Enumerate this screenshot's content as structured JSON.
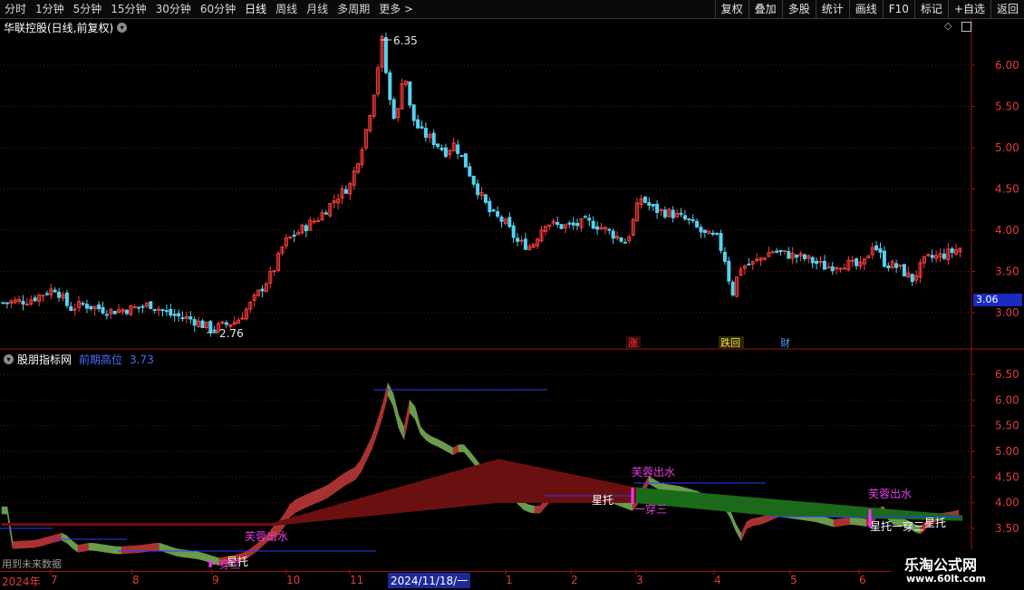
{
  "toolbar": {
    "periods": [
      "分时",
      "1分钟",
      "5分钟",
      "15分钟",
      "30分钟",
      "60分钟",
      "日线",
      "周线",
      "月线",
      "多周期",
      "更多 >"
    ],
    "active_period": "日线",
    "actions": [
      "复权",
      "叠加",
      "多股",
      "统计",
      "画线",
      "F10",
      "标记",
      "+自选",
      "返回"
    ]
  },
  "main_panel": {
    "title": "华联控股(日线,前复权)",
    "high_label": "6.35",
    "low_label": "2.76",
    "current_price": "3.06",
    "markers": [
      "涨",
      "跌回",
      "财"
    ],
    "y_ticks": [
      "6.00",
      "5.50",
      "5.00",
      "4.50",
      "4.00",
      "3.50",
      "3.00"
    ]
  },
  "indicator_panel": {
    "title": "股朋指标网",
    "line_label": "前期高位",
    "line_value": "3.73",
    "y_ticks": [
      "6.50",
      "6.00",
      "5.50",
      "5.00",
      "4.50",
      "4.00",
      "3.50"
    ],
    "annotations": [
      "芙蓉出水",
      "星托",
      "一穿三",
      "星托",
      "一穿三",
      "芙蓉出水",
      "芙蓉出水",
      "星托",
      "星托一穿三"
    ]
  },
  "date_axis": {
    "labels": [
      "2024年",
      "7",
      "8",
      "9",
      "10",
      "11",
      "2024/11/18/一",
      "1",
      "2",
      "3",
      "4",
      "5",
      "6"
    ],
    "future_label": "用到未来数据"
  },
  "watermark": {
    "name": "乐淘公式网",
    "url": "www.60lt.com"
  }
}
